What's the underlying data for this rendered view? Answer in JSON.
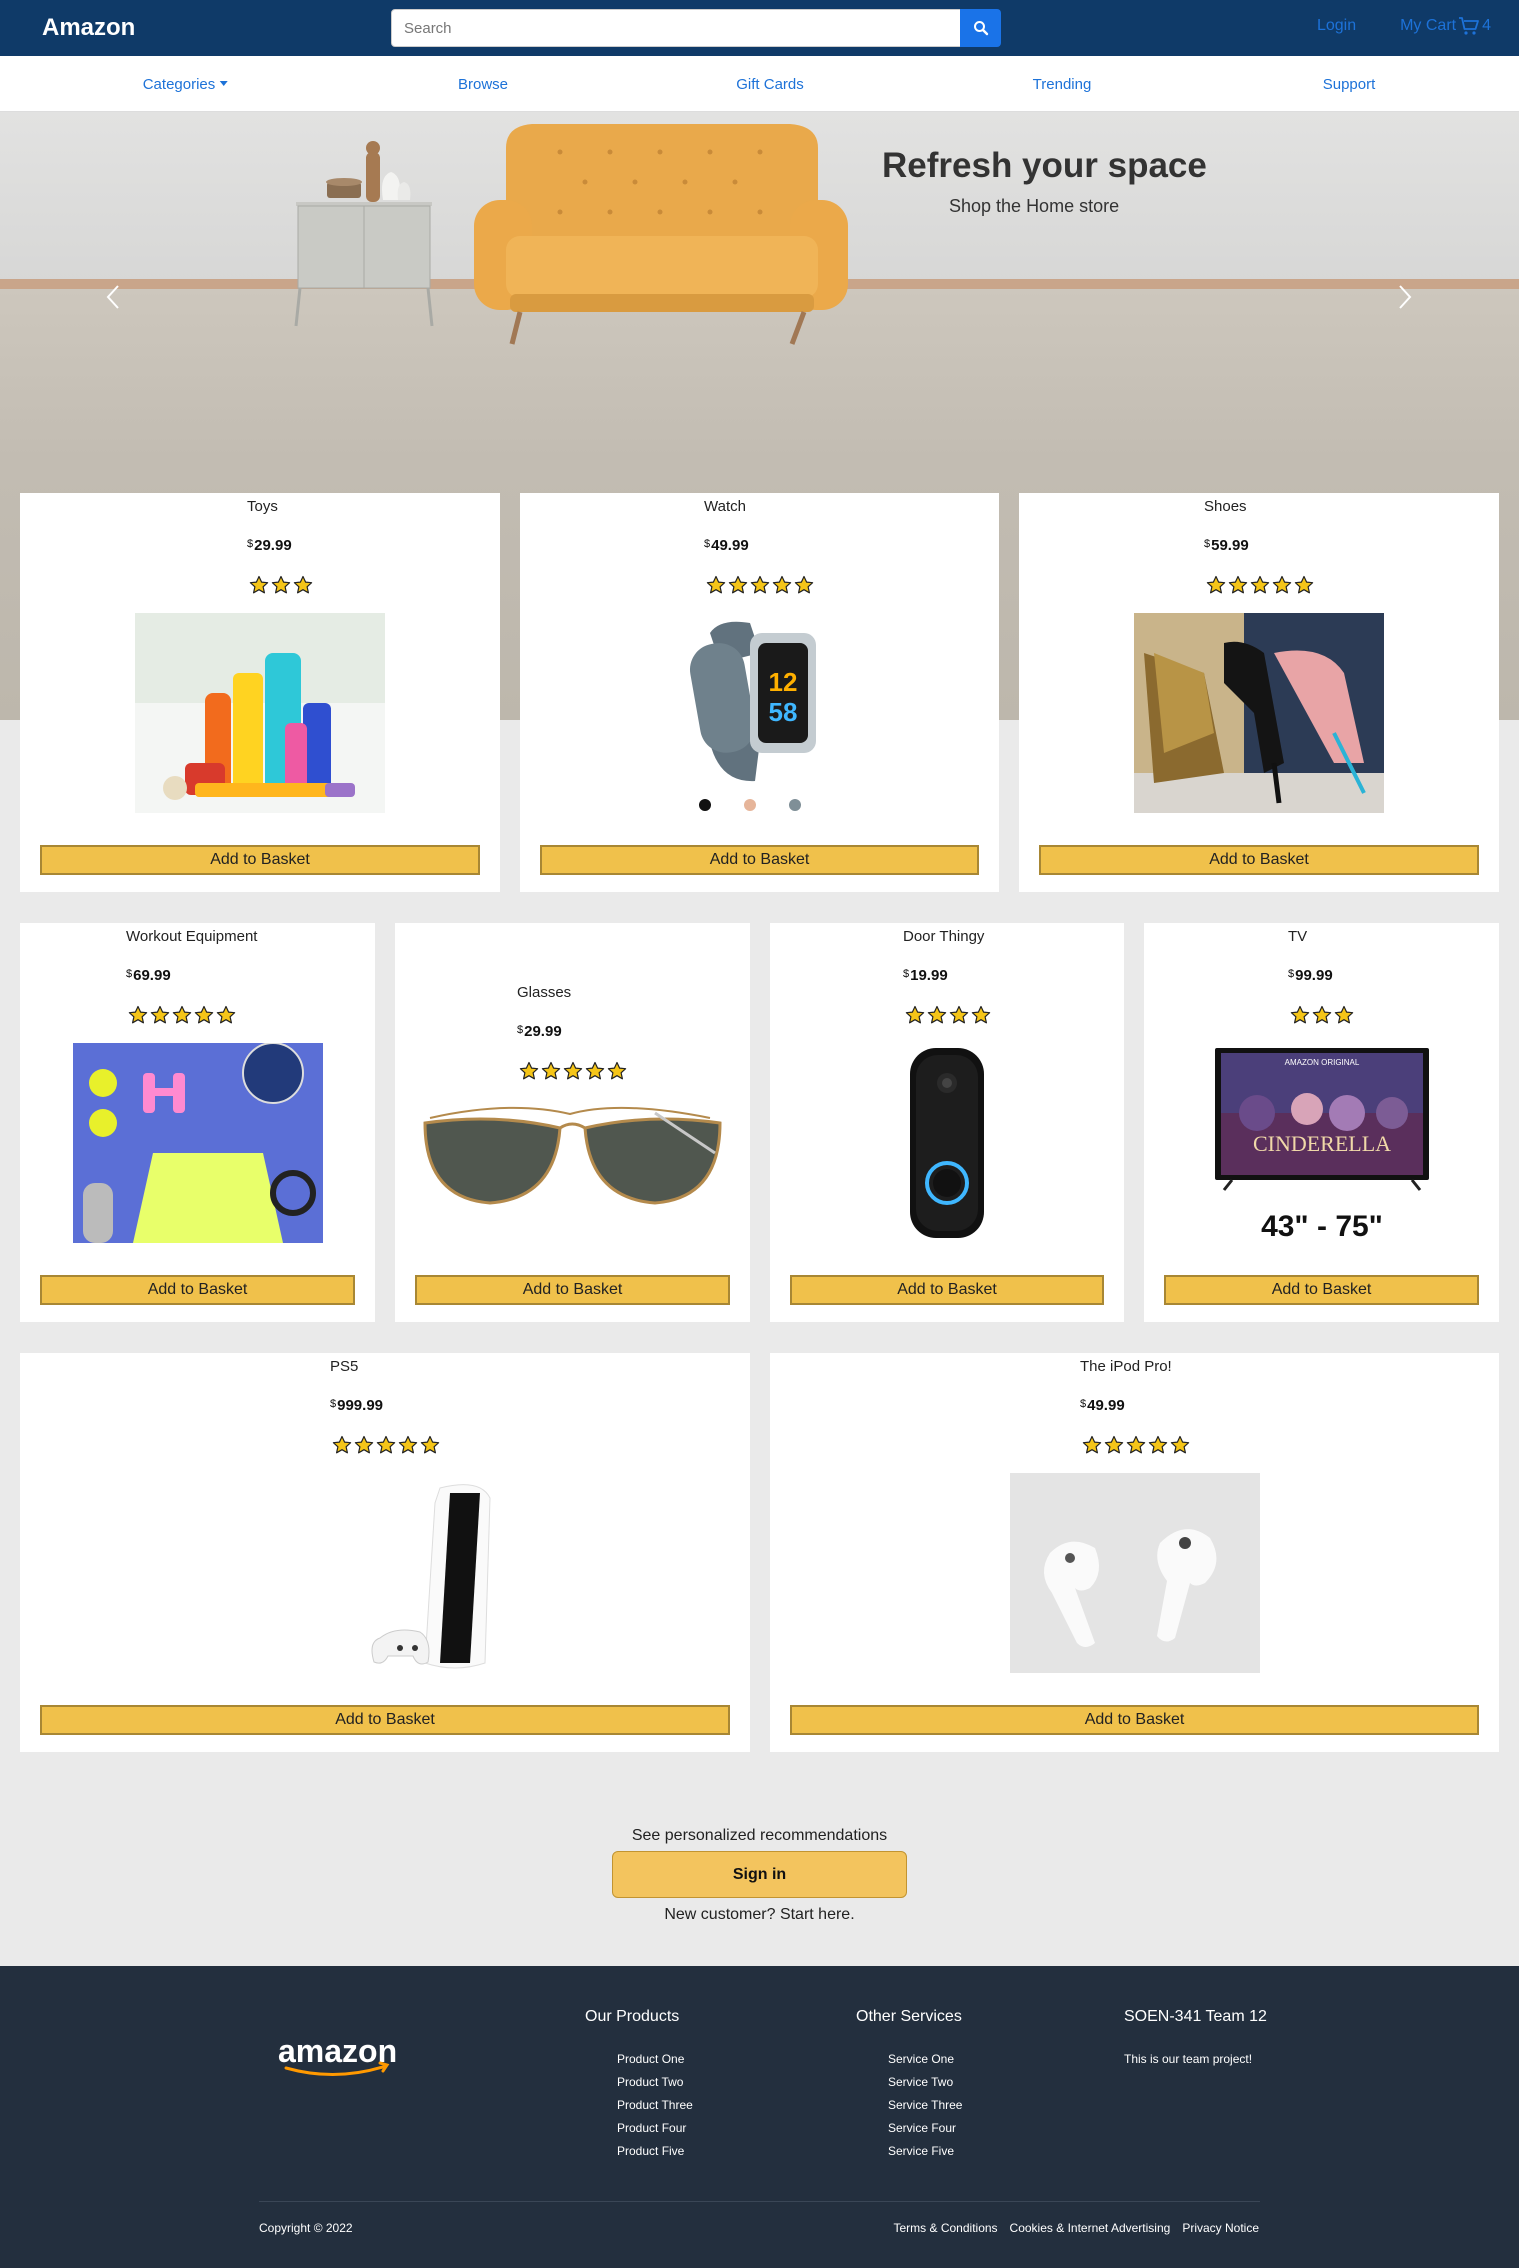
{
  "navbar": {
    "brand": "Amazon",
    "search_placeholder": "Search",
    "login_label": "Login",
    "cart_label": "My Cart",
    "cart_count": "4"
  },
  "subnav": {
    "items": [
      "Categories",
      "Browse",
      "Gift Cards",
      "Trending",
      "Support"
    ]
  },
  "hero": {
    "title": "Refresh your space",
    "subtitle": "Shop the Home store"
  },
  "currency_symbol": "$",
  "basket_label": "Add to Basket",
  "products": [
    {
      "title": "Toys",
      "price": "29.99",
      "rating": 3,
      "image": "cleaning-products"
    },
    {
      "title": "Watch",
      "price": "49.99",
      "rating": 5,
      "image": "fitness-watch"
    },
    {
      "title": "Shoes",
      "price": "59.99",
      "rating": 5,
      "image": "high-heel-shoes"
    },
    {
      "title": "Workout Equipment",
      "price": "69.99",
      "rating": 5,
      "image": "workout-gear"
    },
    {
      "title": "Glasses",
      "price": "29.99",
      "rating": 5,
      "image": "aviator-sunglasses"
    },
    {
      "title": "Door Thingy",
      "price": "19.99",
      "rating": 4,
      "image": "video-doorbell"
    },
    {
      "title": "TV",
      "price": "99.99",
      "rating": 3,
      "image": "television",
      "image_caption": "43\" - 75\"",
      "tv_banner": "AMAZON ORIGINAL",
      "tv_title": "CINDERELLA"
    },
    {
      "title": "PS5",
      "price": "999.99",
      "rating": 5,
      "image": "game-console"
    },
    {
      "title": "The iPod Pro!",
      "price": "49.99",
      "rating": 5,
      "image": "wireless-earbuds"
    }
  ],
  "signin": {
    "prompt": "See personalized recommendations",
    "button": "Sign in",
    "new_customer": "New customer? Start here."
  },
  "footer": {
    "logo_text": "amazon",
    "columns": [
      {
        "title": "Our Products",
        "items": [
          "Product One",
          "Product Two",
          "Product Three",
          "Product Four",
          "Product Five"
        ]
      },
      {
        "title": "Other Services",
        "items": [
          "Service One",
          "Service Two",
          "Service Three",
          "Service Four",
          "Service Five"
        ]
      }
    ],
    "team_title": "SOEN-341 Team 12",
    "team_desc": "This is our team project!",
    "copyright": "Copyright © 2022",
    "links": [
      "Terms & Conditions",
      "Cookies & Internet Advertising",
      "Privacy Notice"
    ]
  },
  "colors": {
    "navbar": "#0f3a68",
    "link": "#1d72d8",
    "button": "#f0c14b",
    "footer": "#232f3e",
    "star": "#f5c518"
  }
}
